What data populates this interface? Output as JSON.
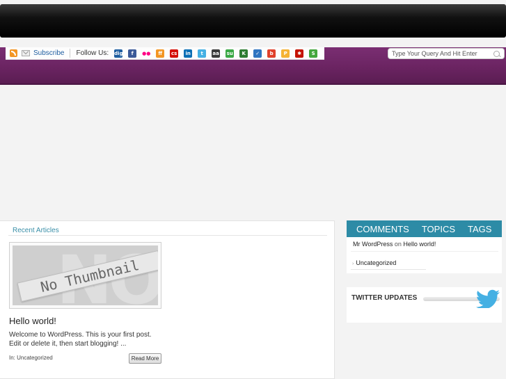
{
  "header": {
    "subscribe_label": "Subscribe",
    "follow_label": "Follow Us:"
  },
  "social_icons": [
    {
      "name": "digg-icon",
      "text": "digg",
      "color": "#1f5ea0"
    },
    {
      "name": "facebook-icon",
      "text": "f",
      "color": "#3b5998"
    },
    {
      "name": "flickr-icon",
      "text": "●●",
      "color": "#ffffff"
    },
    {
      "name": "friendfeed-icon",
      "text": "ff",
      "color": "#f39624"
    },
    {
      "name": "lastfm-icon",
      "text": "cs",
      "color": "#d51007"
    },
    {
      "name": "linkedin-icon",
      "text": "in",
      "color": "#0b6fb5"
    },
    {
      "name": "twitter-icon",
      "text": "t",
      "color": "#45b0e3"
    },
    {
      "name": "reddit-icon",
      "text": "aa",
      "color": "#3a3a3a"
    },
    {
      "name": "stumbleupon-icon",
      "text": "su",
      "color": "#3aa845"
    },
    {
      "name": "technorati-icon",
      "text": "K",
      "color": "#2e7d32"
    },
    {
      "name": "delicious-icon",
      "text": "✓",
      "color": "#2f74c0"
    },
    {
      "name": "blogger-icon",
      "text": "b",
      "color": "#e0402b"
    },
    {
      "name": "posterous-icon",
      "text": "P",
      "color": "#f5b335"
    },
    {
      "name": "yelp-icon",
      "text": "✱",
      "color": "#c41200"
    },
    {
      "name": "scribd-icon",
      "text": "S",
      "color": "#44a73d"
    }
  ],
  "search": {
    "placeholder": "Type Your Query And Hit Enter"
  },
  "recent": {
    "heading": "Recent Articles",
    "thumbnail_text": "No Thumbnail",
    "thumbnail_bg_text": "NO",
    "post_title": "Hello world!",
    "excerpt": "Welcome to WordPress. This is your first post. Edit or delete it, then start blogging! ...",
    "meta": "In: Uncategorized",
    "read_more": "Read More"
  },
  "sidebar": {
    "tabs": [
      "COMMENTS",
      "TOPICS",
      "TAGS"
    ],
    "comment_author": "Mr WordPress",
    "comment_on": "on",
    "comment_post": "Hello world!",
    "category": "Uncategorized",
    "category_arrow": "›",
    "twitter_title": "TWITTER UPDATES"
  },
  "colors": {
    "purple_band": "#6b2462",
    "teal_accent": "#2d8ba6",
    "link_blue": "#1f5ea0"
  }
}
